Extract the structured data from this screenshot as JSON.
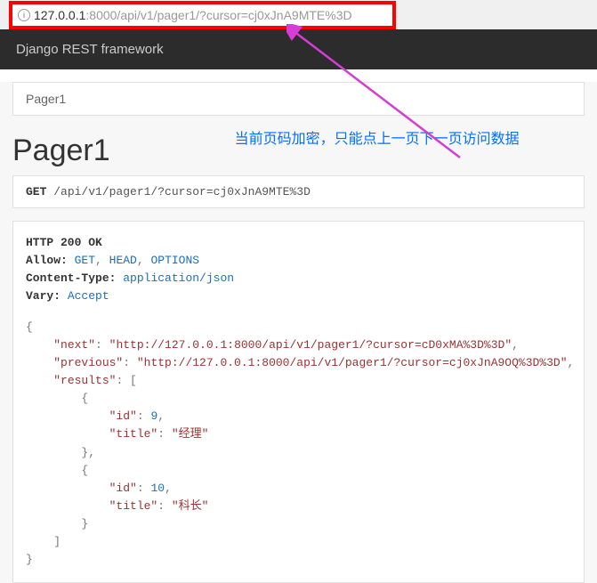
{
  "url": {
    "host": "127.0.0.1",
    "rest": ":8000/api/v1/pager1/?cursor=cj0xJnA9MTE%3D"
  },
  "navbar": {
    "title": "Django REST framework"
  },
  "breadcrumb": {
    "text": "Pager1"
  },
  "page": {
    "title": "Pager1"
  },
  "annotation": {
    "text": "当前页码加密，只能点上一页下一页访问数据"
  },
  "request": {
    "method": "GET",
    "path": "/api/v1/pager1/?cursor=cj0xJnA9MTE%3D"
  },
  "response": {
    "status_line": "HTTP 200 OK",
    "allow_label": "Allow:",
    "allow_methods": [
      "GET",
      "HEAD",
      "OPTIONS"
    ],
    "ctype_label": "Content-Type:",
    "ctype_value": "application/json",
    "vary_label": "Vary:",
    "vary_value": "Accept",
    "json": {
      "next_key": "\"next\"",
      "next_val": "\"http://127.0.0.1:8000/api/v1/pager1/?cursor=cD0xMA%3D%3D\"",
      "prev_key": "\"previous\"",
      "prev_val": "\"http://127.0.0.1:8000/api/v1/pager1/?cursor=cj0xJnA9OQ%3D%3D\"",
      "results_key": "\"results\"",
      "item1_id_key": "\"id\"",
      "item1_id_val": "9",
      "item1_title_key": "\"title\"",
      "item1_title_val": "\"经理\"",
      "item2_id_key": "\"id\"",
      "item2_id_val": "10",
      "item2_title_key": "\"title\"",
      "item2_title_val": "\"科长\""
    }
  }
}
